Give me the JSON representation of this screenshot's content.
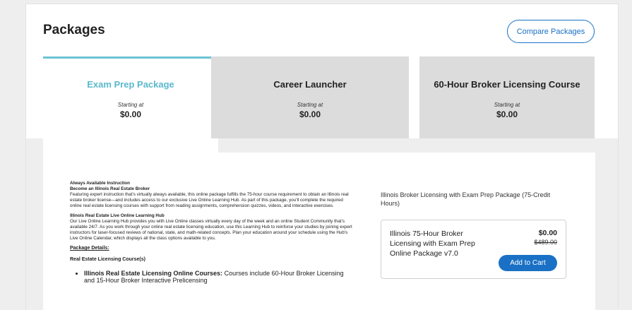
{
  "header": {
    "title": "Packages",
    "compare_label": "Compare Packages"
  },
  "tabs": [
    {
      "name": "Exam Prep Package",
      "starting": "Starting at",
      "price": "$0.00",
      "active": true
    },
    {
      "name": "Career Launcher",
      "starting": "Starting at",
      "price": "$0.00",
      "active": false
    },
    {
      "name": "60-Hour Broker Licensing Course",
      "starting": "Starting at",
      "price": "$0.00",
      "active": false
    }
  ],
  "description": {
    "h1": "Always Available Instruction",
    "h2": "Become an Illinois Real Estate Broker",
    "p1": "Featuring expert instruction that's virtually always available, this online package fulfills the 75-hour course requirement to obtain an Illinois real estate broker license—and includes access to our exclusive Live Online Learning Hub. As part of this package, you'll complete the required online real estate licensing courses with support from reading assignments, comprehension quizzes, videos, and interactive exercises.",
    "h3": "Illinois Real Estate Live Online Learning Hub",
    "p2": "Our Live Online Learning Hub provides you with Live Online classes virtually every day of the week and an online Student Community that's available 24/7. As you work through your online real estate licensing education, use this Learning Hub to reinforce your studies by joining expert instructors for laser-focused reviews of national, state, and math-related concepts. Plan your education around your schedule using the Hub's Live Online Calendar, which displays all the class options available to you.",
    "package_details": "Package Details:",
    "courses_heading": "Real Estate Licensing Course(s)",
    "bullet_bold": "Illinois Real Estate Licensing Online Courses:",
    "bullet_text": " Courses include 60-Hour Broker Licensing and 15-Hour Broker Interactive Prelicensing"
  },
  "sidebar": {
    "title": "Illinois Broker Licensing with Exam Prep Package (75-Credit Hours)",
    "product_name": "Illinois 75-Hour Broker Licensing with Exam Prep Online Package v7.0",
    "price": "$0.00",
    "old_price": "$489.00",
    "add_label": "Add to Cart"
  },
  "colors": {
    "accent": "#1a70c5",
    "active_tab": "#5bb8cc",
    "tab_bg": "#dcdcdc"
  }
}
